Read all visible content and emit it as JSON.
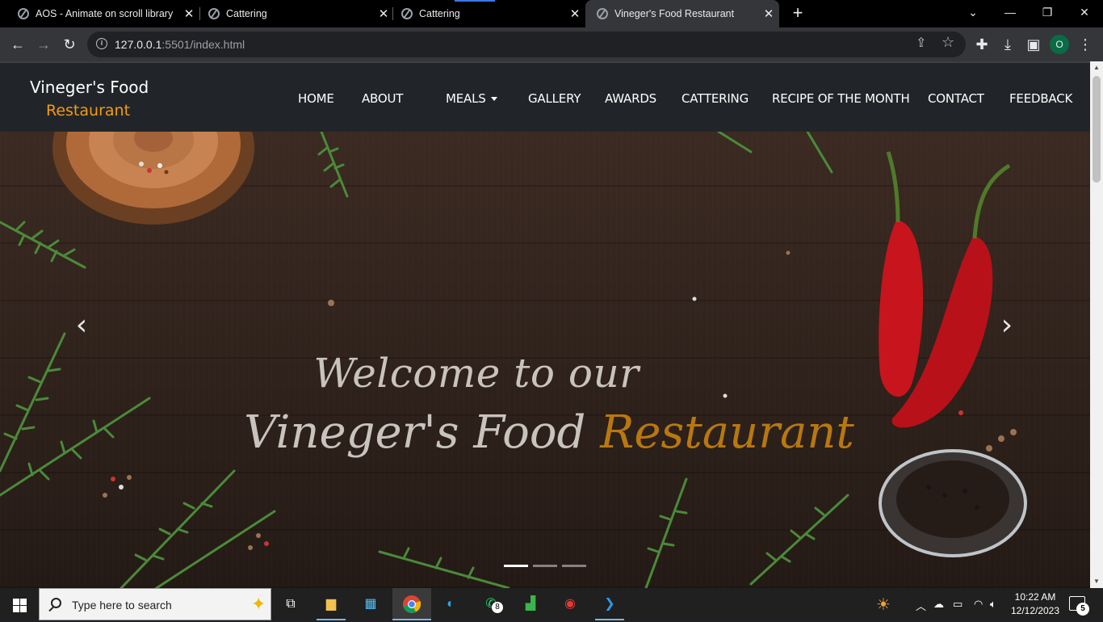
{
  "browser": {
    "tabs": [
      {
        "title": "AOS - Animate on scroll library",
        "active": false
      },
      {
        "title": "Cattering",
        "active": false
      },
      {
        "title": "Cattering",
        "active": false
      },
      {
        "title": "Vineger's Food Restaurant",
        "active": true
      }
    ],
    "url_host": "127.0.0.1",
    "url_rest": ":5501/index.html",
    "profile_initial": "O"
  },
  "site": {
    "brand_line1": "Vineger's Food",
    "brand_line2": "Restaurant",
    "nav": [
      {
        "label": "HOME"
      },
      {
        "label": "ABOUT"
      },
      {
        "label": "MEALS",
        "dropdown": true
      },
      {
        "label": "GALLERY"
      },
      {
        "label": "AWARDS"
      },
      {
        "label": "CATTERING"
      },
      {
        "label": "RECIPE OF THE MONTH"
      },
      {
        "label": "CONTACT"
      },
      {
        "label": "FEEDBACK"
      }
    ],
    "hero": {
      "line1": "Welcome to our",
      "line2_white": "Vineger's Food ",
      "line2_orange": "Restaurant",
      "slides": 3,
      "active_slide": 1
    },
    "colors": {
      "accent": "#f39c12",
      "navbar": "#212529"
    }
  },
  "taskbar": {
    "search_placeholder": "Type here to search",
    "time": "10:22 AM",
    "date": "12/12/2023",
    "whatsapp_badge": "8",
    "notification_count": "5"
  }
}
